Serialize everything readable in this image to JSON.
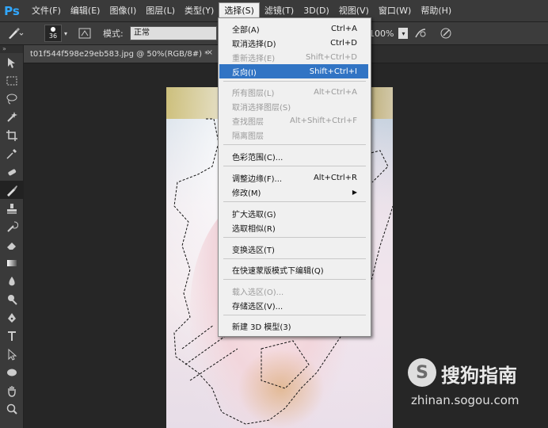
{
  "app": {
    "logo": "Ps"
  },
  "menubar": {
    "items": [
      "文件(F)",
      "编辑(E)",
      "图像(I)",
      "图层(L)",
      "类型(Y)",
      "选择(S)",
      "滤镜(T)",
      "3D(D)",
      "视图(V)",
      "窗口(W)",
      "帮助(H)"
    ],
    "active_index": 5
  },
  "options": {
    "brush_size": "36",
    "mode_label": "模式:",
    "mode_value": "正常",
    "zoom_value": "100%"
  },
  "document_tab": {
    "title": "t01f544f598e29eb583.jpg @ 50%(RGB/8#) *",
    "close": "×"
  },
  "toolbar": {
    "collapse_glyph": "»"
  },
  "select_menu": {
    "items": [
      {
        "label": "全部(A)",
        "shortcut": "Ctrl+A",
        "disabled": false
      },
      {
        "label": "取消选择(D)",
        "shortcut": "Ctrl+D",
        "disabled": false
      },
      {
        "label": "重新选择(E)",
        "shortcut": "Shift+Ctrl+D",
        "disabled": true
      },
      {
        "label": "反向(I)",
        "shortcut": "Shift+Ctrl+I",
        "disabled": false,
        "highlighted": true
      },
      {
        "label": "所有图层(L)",
        "shortcut": "Alt+Ctrl+A",
        "disabled": true
      },
      {
        "label": "取消选择图层(S)",
        "shortcut": "",
        "disabled": true
      },
      {
        "label": "查找图层",
        "shortcut": "Alt+Shift+Ctrl+F",
        "disabled": true
      },
      {
        "label": "隔离图层",
        "shortcut": "",
        "disabled": true
      },
      {
        "label": "色彩范围(C)...",
        "shortcut": "",
        "disabled": false
      },
      {
        "label": "调整边缘(F)...",
        "shortcut": "Alt+Ctrl+R",
        "disabled": false
      },
      {
        "label": "修改(M)",
        "shortcut": "",
        "disabled": false,
        "submenu": true
      },
      {
        "label": "扩大选取(G)",
        "shortcut": "",
        "disabled": false
      },
      {
        "label": "选取相似(R)",
        "shortcut": "",
        "disabled": false
      },
      {
        "label": "变换选区(T)",
        "shortcut": "",
        "disabled": false
      },
      {
        "label": "在快速蒙版模式下编辑(Q)",
        "shortcut": "",
        "disabled": false
      },
      {
        "label": "载入选区(O)...",
        "shortcut": "",
        "disabled": true
      },
      {
        "label": "存储选区(V)...",
        "shortcut": "",
        "disabled": false
      },
      {
        "label": "新建 3D 模型(3)",
        "shortcut": "",
        "disabled": false
      }
    ],
    "submenu_arrow": "▶"
  },
  "watermark": {
    "logo_glyph": "S",
    "name": "搜狗指南",
    "url": "zhinan.sogou.com"
  },
  "colors": {
    "menu_highlight": "#3174c4",
    "ps_blue": "#31a8ff"
  }
}
